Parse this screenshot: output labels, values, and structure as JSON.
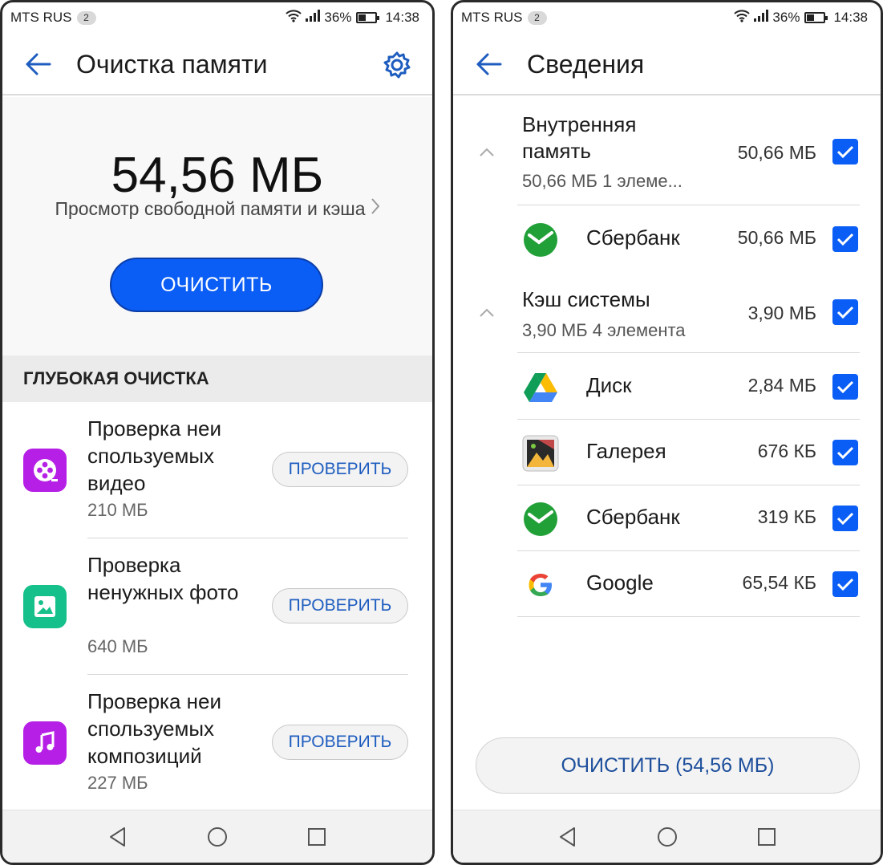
{
  "status_bar": {
    "carrier": "MTS RUS",
    "sim_badge": "2",
    "battery": "36%",
    "battery_level": 0.36,
    "time": "14:38"
  },
  "left_screen": {
    "title": "Очистка памяти",
    "total_size": "54,56 МБ",
    "view_link": "Просмотр свободной памяти и кэша",
    "clean_button": "ОЧИСТИТЬ",
    "section_header": "ГЛУБОКАЯ ОЧИСТКА",
    "items": [
      {
        "title": "Проверка неи спользуемых видео",
        "size": "210 МБ",
        "button": "ПРОВЕРИТЬ",
        "icon": "video-icon",
        "color": "#b620e6"
      },
      {
        "title": "Проверка ненужных фото",
        "size": "640 МБ",
        "button": "ПРОВЕРИТЬ",
        "icon": "photo-icon",
        "color": "#15c08a"
      },
      {
        "title": "Проверка неи спользуемых композиций",
        "size": "227 МБ",
        "button": "ПРОВЕРИТЬ",
        "icon": "music-icon",
        "color": "#b620e6"
      }
    ]
  },
  "right_screen": {
    "title": "Сведения",
    "groups": [
      {
        "title": "Внутренняя память",
        "size": "50,66 МБ",
        "subtitle": "50,66 МБ 1 элеме...",
        "apps": [
          {
            "name": "Сбербанк",
            "size": "50,66 МБ",
            "icon": "sberbank-icon"
          }
        ]
      },
      {
        "title": "Кэш системы",
        "size": "3,90 МБ",
        "subtitle": "3,90 МБ 4 элемента",
        "apps": [
          {
            "name": "Диск",
            "size": "2,84 МБ",
            "icon": "google-drive-icon"
          },
          {
            "name": "Галерея",
            "size": "676 КБ",
            "icon": "gallery-icon"
          },
          {
            "name": "Сбербанк",
            "size": "319 КБ",
            "icon": "sberbank-icon"
          },
          {
            "name": "Google",
            "size": "65,54 КБ",
            "icon": "google-icon"
          }
        ]
      }
    ],
    "clean_button": "ОЧИСТИТЬ (54,56 МБ)"
  },
  "colors": {
    "accent": "#0a5df5",
    "link_text": "#1e5dbf",
    "section_bg": "#ebebeb"
  }
}
